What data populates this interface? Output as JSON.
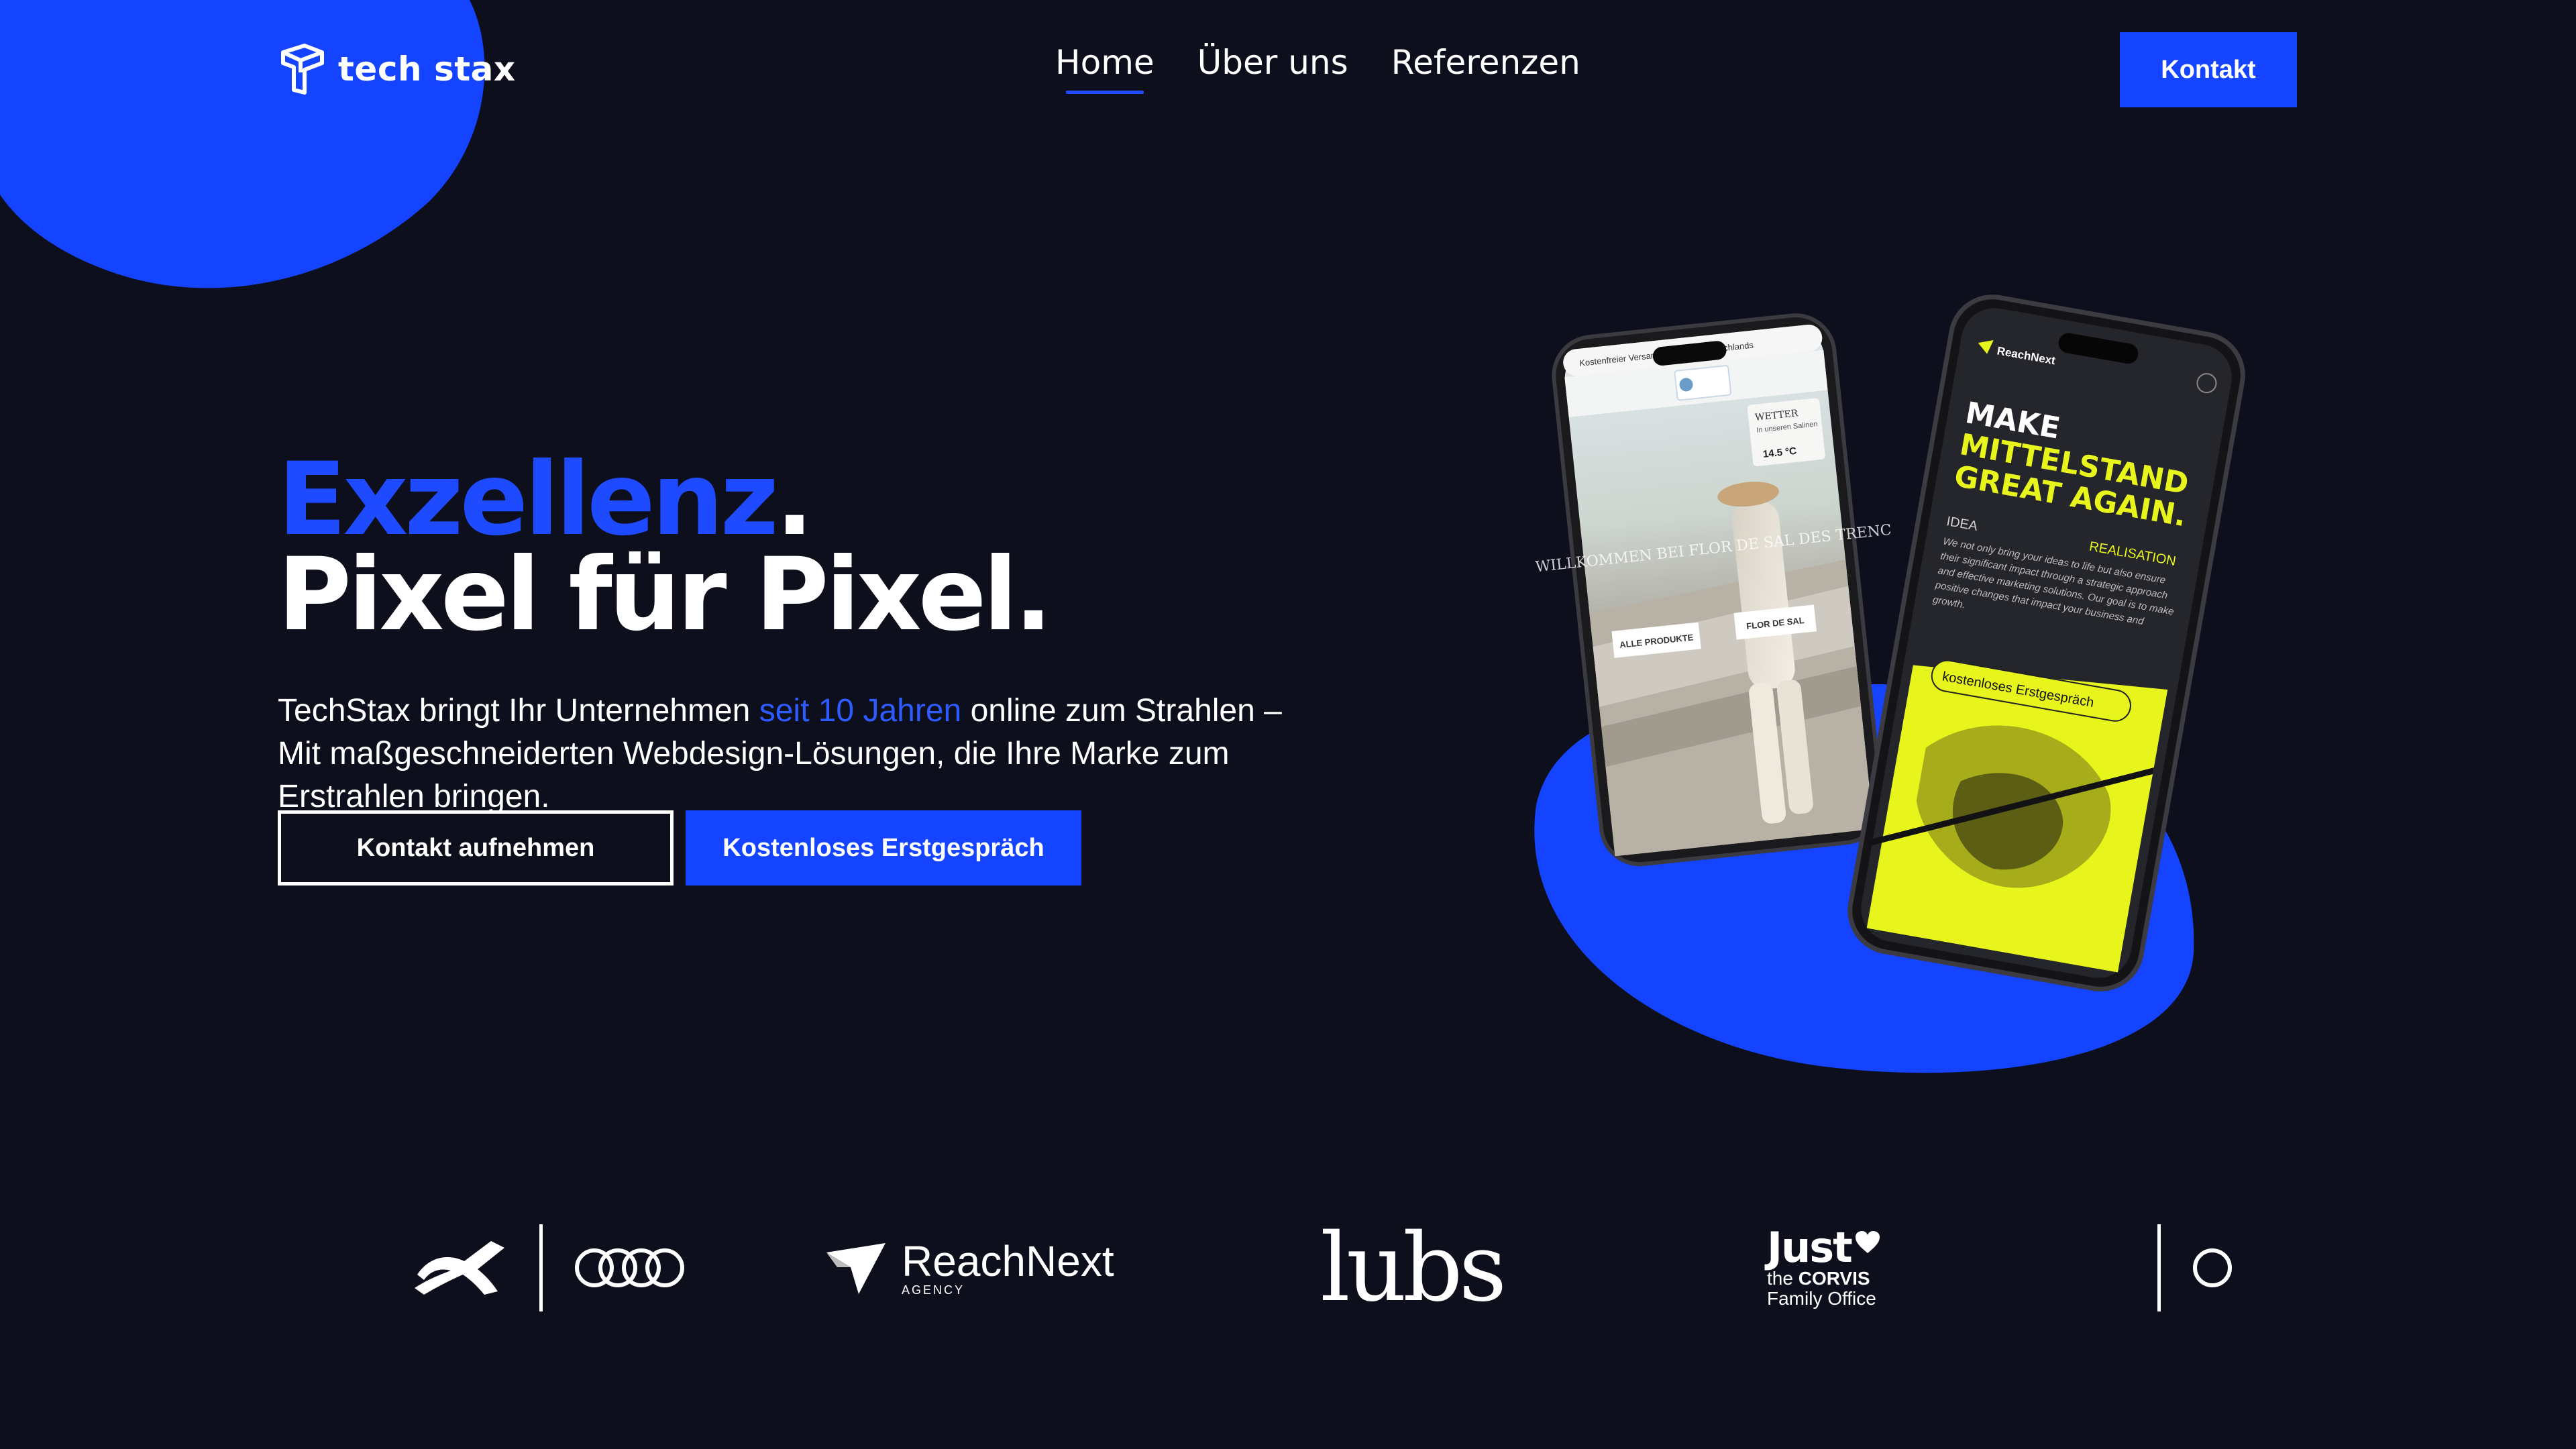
{
  "header": {
    "brand": "tech stax",
    "nav": [
      {
        "label": "Home",
        "active": true
      },
      {
        "label": "Über uns",
        "active": false
      },
      {
        "label": "Referenzen",
        "active": false
      }
    ],
    "contact_button": "Kontakt"
  },
  "hero": {
    "headline_accent": "Exzellenz",
    "headline_dot": ".",
    "headline_line2": "Pixel für Pixel.",
    "text_before": "TechStax bringt Ihr Unternehmen ",
    "text_highlight": "seit 10 Jahren",
    "text_after": " online zum Strahlen – Mit maßgeschneiderten Webdesign-Lösungen, die Ihre Marke zum Erstrahlen bringen.",
    "cta_secondary": "Kontakt aufnehmen",
    "cta_primary": "Kostenloses Erstgespräch"
  },
  "phone_left": {
    "top_bar": "Kostenfreier Versand innerhalb Deutschlands",
    "weather_title": "WETTER",
    "weather_sub": "In unseren Salinen",
    "weather_temp": "14.5 °C",
    "hero_text": "WILLKOMMEN BEI FLOR DE SAL DES TRENC",
    "btn1": "ALLE PRODUKTE",
    "btn2": "FLOR DE SAL"
  },
  "phone_right": {
    "brand": "ReachNext",
    "headline1": "MAKE",
    "headline2": "MITTELSTAND",
    "headline3": "GREAT AGAIN.",
    "label_idea": "IDEA",
    "label_realisation": "REALISATION",
    "body": "We not only bring your ideas to life but also ensure their significant impact through a strategic approach and effective marketing solutions. Our goal is to make positive changes that impact your business and growth.",
    "cta": "kostenloses Erstgespräch"
  },
  "client_logos": {
    "reachnext_name": "ReachNext",
    "reachnext_sub": "AGENCY",
    "lubs": "lubs",
    "just": "Just",
    "just_the": "the",
    "just_corvis": "CORVIS",
    "just_family": "Family Office"
  },
  "colors": {
    "background": "#0e0f1d",
    "accent_blue": "#1444ff",
    "lime": "#e8f51c"
  }
}
